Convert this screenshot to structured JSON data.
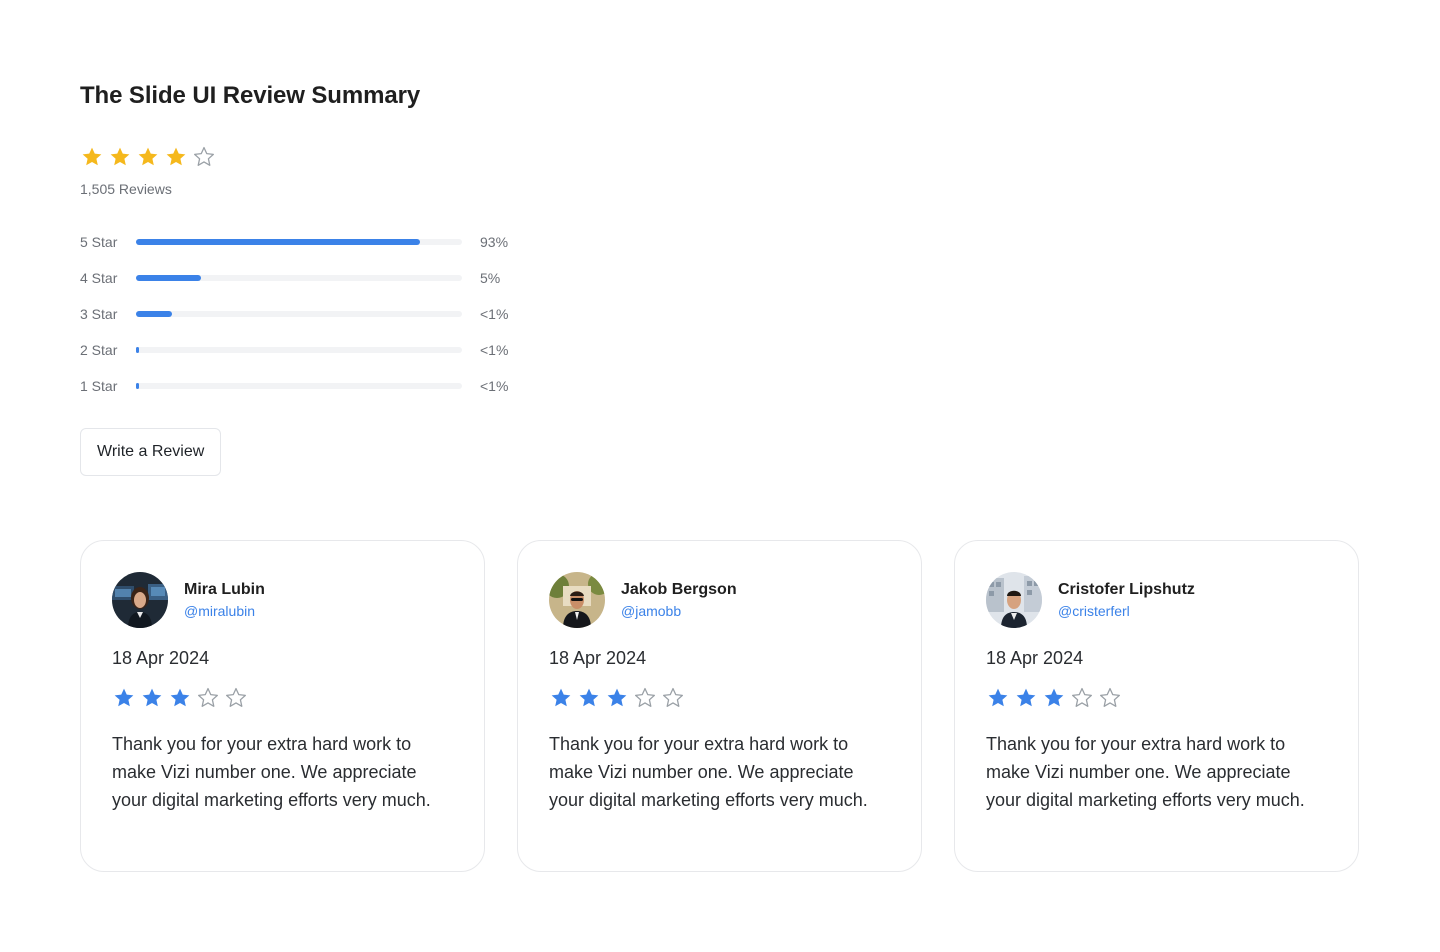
{
  "summary": {
    "title": "The Slide UI Review Summary",
    "rating": 4,
    "max_rating": 5,
    "reviews_label": "1,505 Reviews",
    "star_color": "#F5B81C",
    "empty_star_color": "#9aa0a6",
    "bar_color": "#3B82E8"
  },
  "distribution": [
    {
      "label": "5 Star",
      "percent_text": "93%",
      "fill_fraction": 0.87
    },
    {
      "label": "4 Star",
      "percent_text": "5%",
      "fill_fraction": 0.2
    },
    {
      "label": "3 Star",
      "percent_text": "<1%",
      "fill_fraction": 0.11
    },
    {
      "label": "2 Star",
      "percent_text": "<1%",
      "fill_fraction": 0.01
    },
    {
      "label": "1 Star",
      "percent_text": "<1%",
      "fill_fraction": 0.01
    }
  ],
  "write_review_label": "Write a Review",
  "reviews": [
    {
      "name": "Mira Lubin",
      "handle": "@miralubin",
      "date": "18 Apr 2024",
      "rating": 3,
      "text": "Thank you for your extra hard work to make Vizi number one. We appreciate your digital marketing efforts very much.",
      "avatar": "avatar-photo-woman"
    },
    {
      "name": "Jakob Bergson",
      "handle": "@jamobb",
      "date": "18 Apr 2024",
      "rating": 3,
      "text": "Thank you for your extra hard work to make Vizi number one. We appreciate your digital marketing efforts very much.",
      "avatar": "avatar-photo-man-outdoors"
    },
    {
      "name": "Cristofer Lipshutz",
      "handle": "@cristerferl",
      "date": "18 Apr 2024",
      "rating": 3,
      "text": "Thank you for your extra hard work to make Vizi number one. We appreciate your digital marketing efforts very much.",
      "avatar": "avatar-photo-man-building"
    }
  ],
  "review_star_color": "#3B82E8"
}
